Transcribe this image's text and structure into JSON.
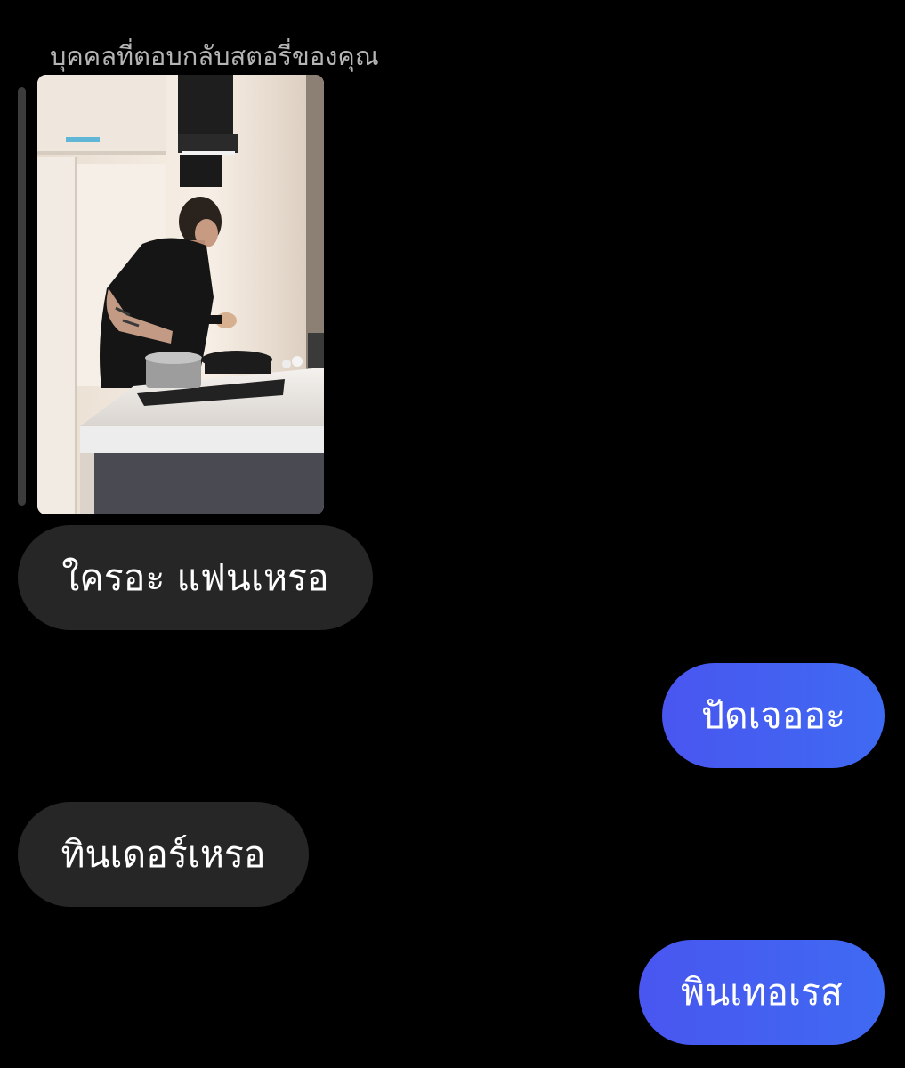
{
  "story_reply": {
    "caption": "บุคคลที่ตอบกลับสตอรี่ของคุณ",
    "thumbnail": "story-photo-man-cooking-in-kitchen"
  },
  "messages": [
    {
      "direction": "incoming",
      "text": "ใครอะ แฟนเหรอ"
    },
    {
      "direction": "outgoing",
      "text": "ปัดเจออะ"
    },
    {
      "direction": "incoming",
      "text": "ทินเดอร์เหรอ"
    },
    {
      "direction": "outgoing",
      "text": "พินเทอเรส"
    }
  ],
  "colors": {
    "background": "#000000",
    "incoming_bubble": "#262626",
    "outgoing_bubble": "#4a5cf2",
    "caption_text": "#b5b5b5",
    "bubble_text": "#ffffff"
  }
}
